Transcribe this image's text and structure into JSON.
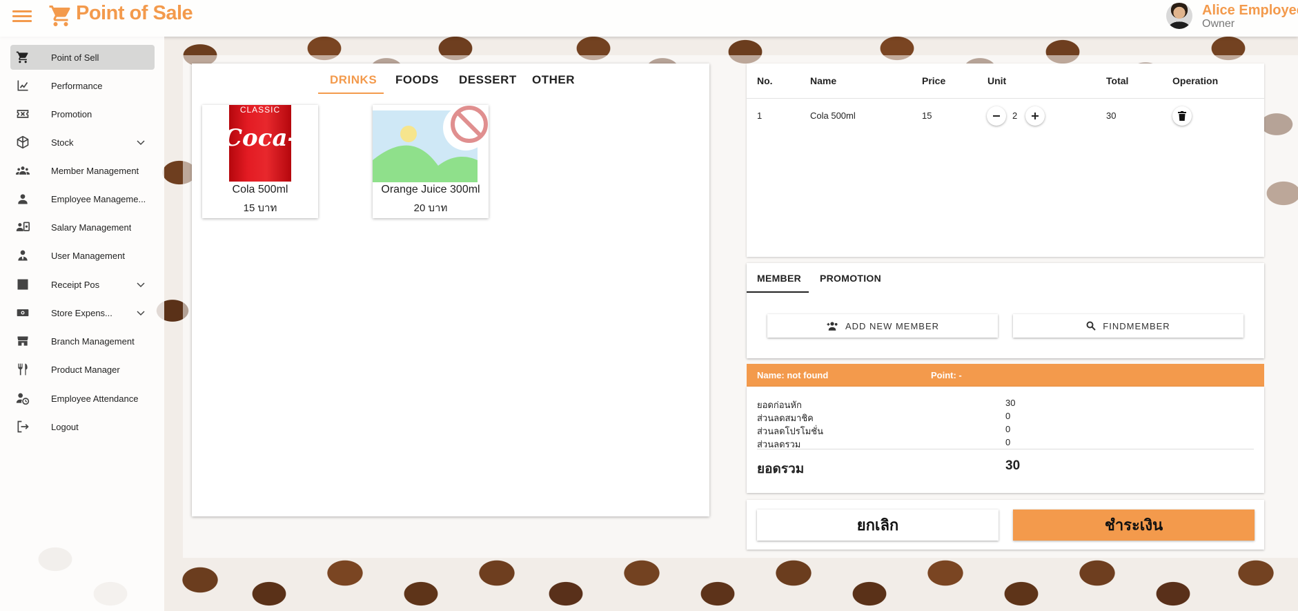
{
  "header": {
    "title": "Point of Sale",
    "user_name": "Alice Employee",
    "user_role": "Owner"
  },
  "colors": {
    "accent": "#f39a4c"
  },
  "sidebar": {
    "items": [
      {
        "label": "Point of Sell",
        "icon": "cart-icon",
        "active": true
      },
      {
        "label": "Performance",
        "icon": "chart-icon"
      },
      {
        "label": "Promotion",
        "icon": "ticket-icon"
      },
      {
        "label": "Stock",
        "icon": "box-icon",
        "expandable": true
      },
      {
        "label": "Member Management",
        "icon": "group-icon"
      },
      {
        "label": "Employee Manageme...",
        "icon": "person-icon"
      },
      {
        "label": "Salary Management",
        "icon": "salary-icon"
      },
      {
        "label": "User Management",
        "icon": "user-tie-icon"
      },
      {
        "label": "Receipt Pos",
        "icon": "receipt-icon",
        "expandable": true
      },
      {
        "label": "Store Expens...",
        "icon": "cash-icon",
        "expandable": true
      },
      {
        "label": "Branch Management",
        "icon": "store-icon"
      },
      {
        "label": "Product Manager",
        "icon": "utensils-icon"
      },
      {
        "label": "Employee Attendance",
        "icon": "attendance-icon"
      },
      {
        "label": "Logout",
        "icon": "logout-icon"
      }
    ]
  },
  "categories": {
    "tabs": [
      "DRINKS",
      "FOODS",
      "DESSERT",
      "OTHER"
    ],
    "active": "DRINKS"
  },
  "products": [
    {
      "name": "Cola 500ml",
      "price": "15 บาท",
      "image_label": "CLASSIC",
      "image_script": "Coca-Cola"
    },
    {
      "name": "Orange Juice 300ml",
      "price": "20 บาท"
    }
  ],
  "order_table": {
    "headers": [
      "No.",
      "Name",
      "Price",
      "Unit",
      "Total",
      "Operation"
    ],
    "rows": [
      {
        "no": "1",
        "name": "Cola 500ml",
        "price": "15",
        "unit": "2",
        "total": "30"
      }
    ]
  },
  "member_tabs": {
    "tabs": [
      "MEMBER",
      "PROMOTION"
    ],
    "active": "MEMBER",
    "add_member_label": "ADD NEW MEMBER",
    "find_member_label": "FINDMEMBER"
  },
  "member_info": {
    "name_text": "Name: not found",
    "point_text": "Point: -"
  },
  "summary": {
    "rows": [
      {
        "label": "ยอดก่อนหัก",
        "value": "30"
      },
      {
        "label": "ส่วนลดสมาชิค",
        "value": "0"
      },
      {
        "label": "ส่วนลดโปรโมชั่น",
        "value": "0"
      },
      {
        "label": "ส่วนลดรวม",
        "value": "0"
      }
    ],
    "total_label": "ยอดรวม",
    "total_value": "30"
  },
  "actions": {
    "cancel_label": "ยกเลิก",
    "pay_label": "ชำระเงิน"
  }
}
